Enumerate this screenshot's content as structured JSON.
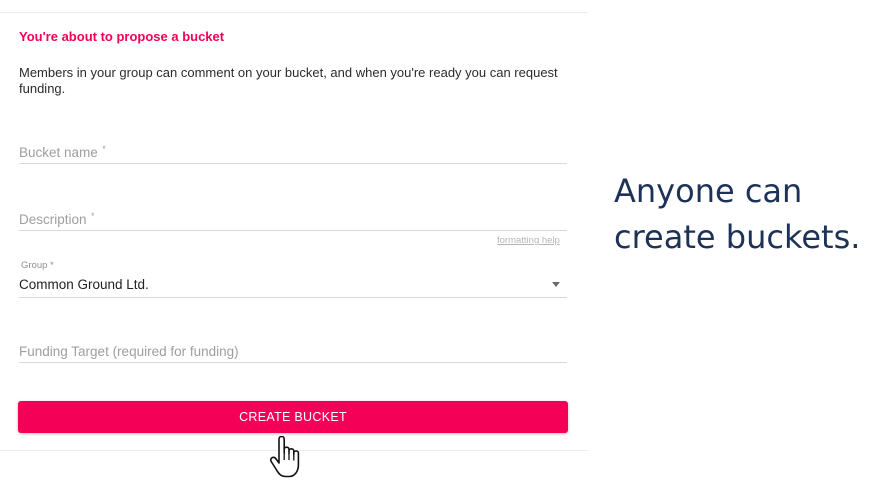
{
  "form": {
    "heading": "You're about to propose a bucket",
    "intro": "Members in your group can comment on your bucket, and when you're ready you can request funding.",
    "bucket_name_placeholder": "Bucket name",
    "description_placeholder": "Description",
    "required_mark": "*",
    "formatting_help": "formatting help",
    "group_label": "Group *",
    "group_value": "Common Ground Ltd.",
    "funding_target_placeholder": "Funding Target (required for funding)",
    "submit_label": "CREATE BUCKET"
  },
  "caption": {
    "text": "Anyone can create buckets."
  },
  "colors": {
    "accent": "#f50057",
    "caption": "#1d3257"
  },
  "icons": {
    "cursor": "hand-pointer-icon",
    "dropdown": "caret-down-icon"
  }
}
